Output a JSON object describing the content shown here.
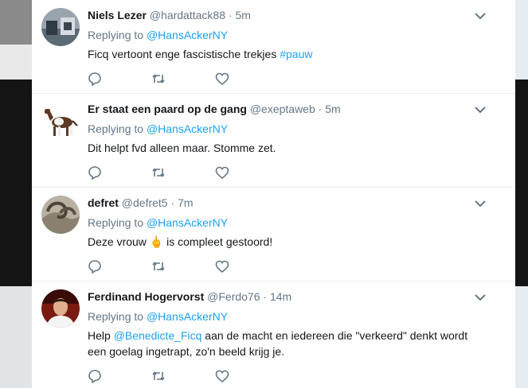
{
  "tweets": [
    {
      "name": "Niels Lezer",
      "handle": "@hardattack88",
      "time": "5m",
      "replying_prefix": "Replying to",
      "replying_to": "@HansAckerNY",
      "text": "Ficq vertoont enge fascistische trekjes",
      "hashtag": "#pauw"
    },
    {
      "name": "Er staat een paard op de gang",
      "handle": "@exeptaweb",
      "time": "5m",
      "replying_prefix": "Replying to",
      "replying_to": "@HansAckerNY",
      "text": "Dit helpt fvd alleen maar. Stomme zet."
    },
    {
      "name": "defret",
      "handle": "@defret5",
      "time": "7m",
      "replying_prefix": "Replying to",
      "replying_to": "@HansAckerNY",
      "text_before": "Deze vrouw",
      "emoji": "🖕",
      "text_after": "is compleet gestoord!"
    },
    {
      "name": "Ferdinand Hogervorst",
      "handle": "@Ferdo76",
      "time": "14m",
      "replying_prefix": "Replying to",
      "replying_to": "@HansAckerNY",
      "text_before": "Help",
      "mention": "@Benedicte_Ficq",
      "text_after": "aan de macht en iedereen die \"verkeerd\" denkt wordt een goelag ingetrapt, zo'n beeld krijg je."
    }
  ],
  "icons": {
    "reply": "reply-icon",
    "retweet": "retweet-icon",
    "like": "like-icon",
    "caret": "chevron-down-icon"
  },
  "colors": {
    "link": "#1da1f2",
    "secondary_text": "#657786",
    "primary_text": "#14171a",
    "divider": "#e6ecf0"
  }
}
